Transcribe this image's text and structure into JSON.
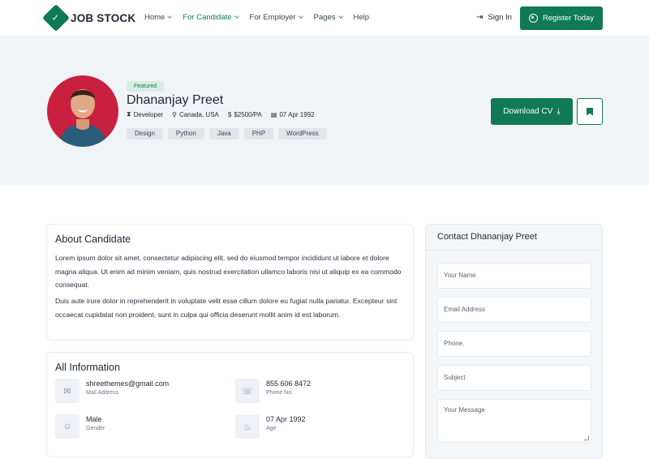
{
  "nav": {
    "logo_text": "JOB STOCK",
    "menu": [
      {
        "label": "Home",
        "active": false
      },
      {
        "label": "For Candidate",
        "active": true
      },
      {
        "label": "For Employer",
        "active": false
      },
      {
        "label": "Pages",
        "active": false
      },
      {
        "label": "Help",
        "active": false
      }
    ],
    "signin_label": "Sign In",
    "register_label": "Register Today"
  },
  "profile": {
    "badge": "Featured",
    "name": "Dhananjay Preet",
    "meta": {
      "role": "Developer",
      "location": "Canada, USA",
      "salary": "$2500/PA",
      "date": "07 Apr 1992"
    },
    "skills": [
      "Design",
      "Python",
      "Java",
      "PHP",
      "WordPress"
    ],
    "download_label": "Download CV"
  },
  "about": {
    "title": "About Candidate",
    "p1": "Lorem ipsum dolor sit amet, consectetur adipiscing elit, sed do eiusmod tempor incididunt ut labore et dolore magna aliqua. Ut enim ad minim veniam, quis nostrud exercitation ullamco laboris nisi ut aliquip ex ea commodo consequat.",
    "p2": "Duis aute irure dolor in reprehenderit in voluptate velit esse cillum dolore eu fugiat nulla pariatur. Excepteur sint occaecat cupidatat non proident, sunt in culpa qui officia deserunt mollit anim id est laborum."
  },
  "info": {
    "title": "All Information",
    "items": [
      {
        "value": "shreethemes@gmail.com",
        "label": "Mail Address",
        "icon": "mail-icon"
      },
      {
        "value": "855 606 8472",
        "label": "Phone No.",
        "icon": "phone-icon"
      },
      {
        "value": "Male",
        "label": "Gender",
        "icon": "user-icon"
      },
      {
        "value": "07 Apr 1992",
        "label": "Age",
        "icon": "cake-icon"
      }
    ]
  },
  "contact": {
    "title": "Contact Dhananjay Preet",
    "name_placeholder": "Your Name",
    "email_placeholder": "Email Address",
    "phone_placeholder": "Phone.",
    "subject_placeholder": "Subject",
    "message_placeholder": "Your Message"
  },
  "colors": {
    "accent": "#0f7a55",
    "hero_bg": "#f1f4f7",
    "avatar_bg": "#c9203f"
  }
}
